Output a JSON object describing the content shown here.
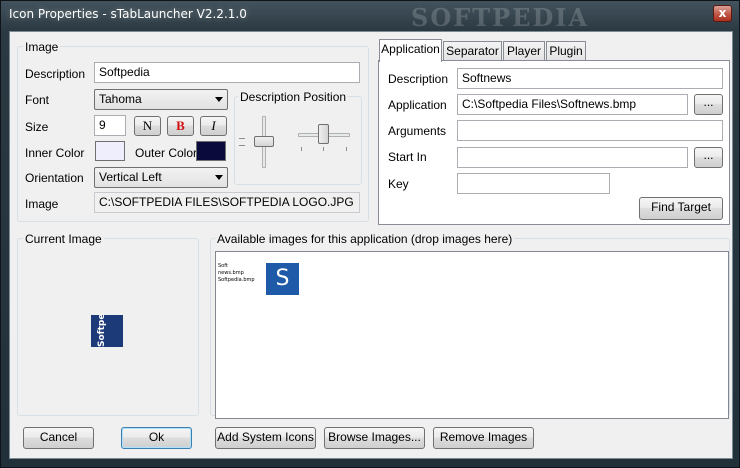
{
  "window": {
    "title": "Icon Properties - sTabLauncher V2.2.1.0",
    "watermark": "SOFTPEDIA",
    "close_glyph": "x"
  },
  "image_group": {
    "label": "Image",
    "description_label": "Description",
    "description_value": "Softpedia",
    "font_label": "Font",
    "font_value": "Tahoma",
    "size_label": "Size",
    "size_value": "9",
    "normal_label": "N",
    "bold_label": "B",
    "italic_label": "I",
    "inner_color_label": "Inner Color",
    "inner_color": "#eeeefc",
    "outer_color_label": "Outer Color",
    "outer_color": "#0a0a3c",
    "orientation_label": "Orientation",
    "orientation_value": "Vertical Left",
    "image_label": "Image",
    "image_value": "C:\\SOFTPEDIA FILES\\SOFTPEDIA LOGO.JPG",
    "position_label": "Description Position"
  },
  "tabs": [
    {
      "label": "Application",
      "active": true
    },
    {
      "label": "Separator"
    },
    {
      "label": "Player"
    },
    {
      "label": "Plugin"
    }
  ],
  "application_tab": {
    "description_label": "Description",
    "description_value": "Softnews",
    "application_label": "Application",
    "application_value": "C:\\Softpedia Files\\Softnews.bmp",
    "arguments_label": "Arguments",
    "arguments_value": "",
    "start_in_label": "Start In",
    "start_in_value": "",
    "key_label": "Key",
    "key_value": "",
    "browse_label": "...",
    "find_target_label": "Find Target"
  },
  "current_image": {
    "label": "Current Image",
    "icon_text": "Softpedia",
    "icon_color": "#1c3a78"
  },
  "available_images": {
    "label": "Available images for this application   (drop images here)",
    "thumb_lines": [
      "Soft",
      "news.bmp",
      "Softpedia.bmp"
    ],
    "thumb_icon_letter": "S",
    "thumb_icon_color": "#1e5aa8"
  },
  "buttons": {
    "cancel": "Cancel",
    "ok": "Ok",
    "add_system_icons": "Add System Icons",
    "browse_images": "Browse Images...",
    "remove_images": "Remove Images"
  }
}
